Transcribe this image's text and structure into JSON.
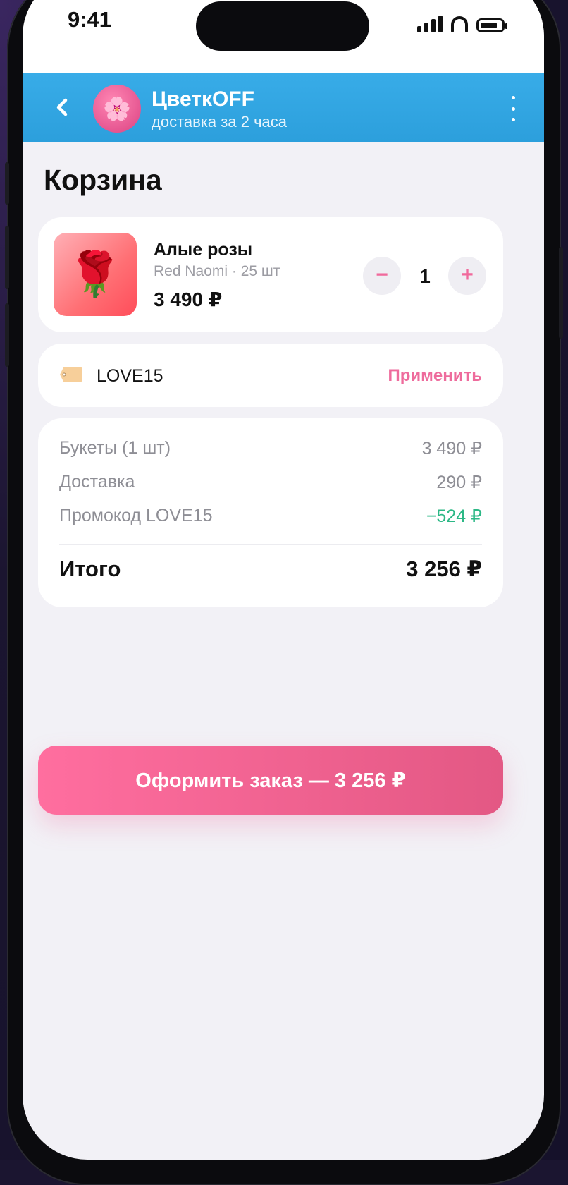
{
  "status_bar": {
    "time": "9:41"
  },
  "header": {
    "back_icon": "chevron-left-icon",
    "logo_icon": "flower-icon",
    "logo_glyph": "🌸",
    "shop_name": "ЦветкOFF",
    "subtitle": "доставка за 2 часа",
    "menu_icon": "more-vertical-icon",
    "color": "#34a8e4"
  },
  "page": {
    "title": "Корзина"
  },
  "cart": {
    "items": [
      {
        "image_glyph": "🌹",
        "name": "Алые розы",
        "details": "Red Naomi · 25 шт",
        "price": "3 490 ₽",
        "quantity": "1",
        "minus_label": "−",
        "plus_label": "+"
      }
    ]
  },
  "promo": {
    "icon": "tag-icon",
    "code": "LOVE15",
    "apply_label": "Применить",
    "accent": "#ee6b9c"
  },
  "summary": {
    "rows": [
      {
        "label": "Букеты (1 шт)",
        "value": "3 490 ₽"
      },
      {
        "label": "Доставка",
        "value": "290 ₽"
      },
      {
        "label": "Промокод LOVE15",
        "value": "−524 ₽",
        "color": "#2cb886"
      }
    ],
    "total_label": "Итого",
    "total_value": "3 256 ₽"
  },
  "checkout": {
    "label": "Оформить заказ — 3 256 ₽",
    "color": "#f0668f"
  }
}
